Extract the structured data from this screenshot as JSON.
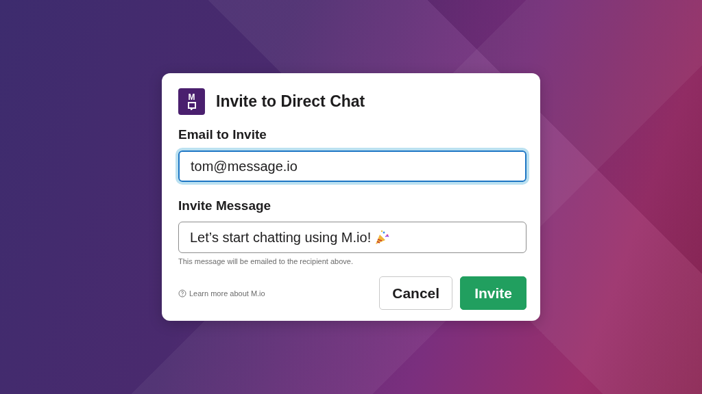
{
  "dialog": {
    "logo": "M",
    "title": "Invite to Direct Chat",
    "fields": [
      {
        "label": "Email to Invite",
        "value": "tom@message.io",
        "focused": true
      },
      {
        "label": "Invite Message",
        "value": "Let’s start chatting using M.io!",
        "focused": false,
        "emoji": true,
        "hint": "This message will be emailed to the recipient above."
      }
    ],
    "help_link": "Learn more about M.io",
    "buttons": [
      {
        "label": "Cancel",
        "kind": "secondary"
      },
      {
        "label": "Invite",
        "kind": "primary"
      }
    ]
  }
}
